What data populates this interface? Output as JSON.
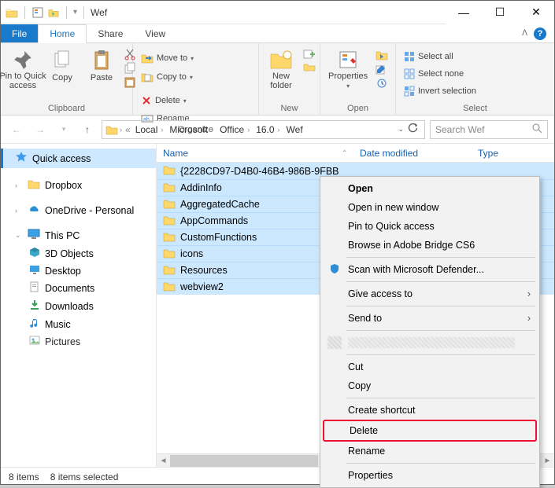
{
  "title": "Wef",
  "window_controls": {
    "min": "—",
    "max": "☐",
    "close": "✕"
  },
  "ribbon_tabs": {
    "file": "File",
    "home": "Home",
    "share": "Share",
    "view": "View"
  },
  "ribbon": {
    "clipboard": {
      "label": "Clipboard",
      "pin": "Pin to Quick\naccess",
      "copy": "Copy",
      "paste": "Paste"
    },
    "organize": {
      "label": "Organize",
      "moveto": "Move to",
      "copyto": "Copy to",
      "delete": "Delete",
      "rename": "Rename"
    },
    "new": {
      "label": "New",
      "newfolder": "New\nfolder"
    },
    "open": {
      "label": "Open",
      "properties": "Properties"
    },
    "select": {
      "label": "Select",
      "all": "Select all",
      "none": "Select none",
      "invert": "Invert selection"
    }
  },
  "breadcrumb": [
    "Local",
    "Microsoft",
    "Office",
    "16.0",
    "Wef"
  ],
  "search_placeholder": "Search Wef",
  "nav": {
    "quick": "Quick access",
    "dropbox": "Dropbox",
    "onedrive": "OneDrive - Personal",
    "thispc": "This PC",
    "threed": "3D Objects",
    "desktop": "Desktop",
    "documents": "Documents",
    "downloads": "Downloads",
    "music": "Music",
    "pictures": "Pictures"
  },
  "columns": {
    "name": "Name",
    "date": "Date modified",
    "type": "Type"
  },
  "rows": [
    "{2228CD97-D4B0-46B4-986B-9FBB",
    "AddinInfo",
    "AggregatedCache",
    "AppCommands",
    "CustomFunctions",
    "icons",
    "Resources",
    "webview2"
  ],
  "status": {
    "items": "8 items",
    "selected": "8 items selected"
  },
  "context_menu": {
    "open": "Open",
    "open_new": "Open in new window",
    "pin": "Pin to Quick access",
    "bridge": "Browse in Adobe Bridge CS6",
    "defender": "Scan with Microsoft Defender...",
    "give": "Give access to",
    "sendto": "Send to",
    "cut": "Cut",
    "copy": "Copy",
    "shortcut": "Create shortcut",
    "delete": "Delete",
    "rename": "Rename",
    "properties": "Properties"
  }
}
